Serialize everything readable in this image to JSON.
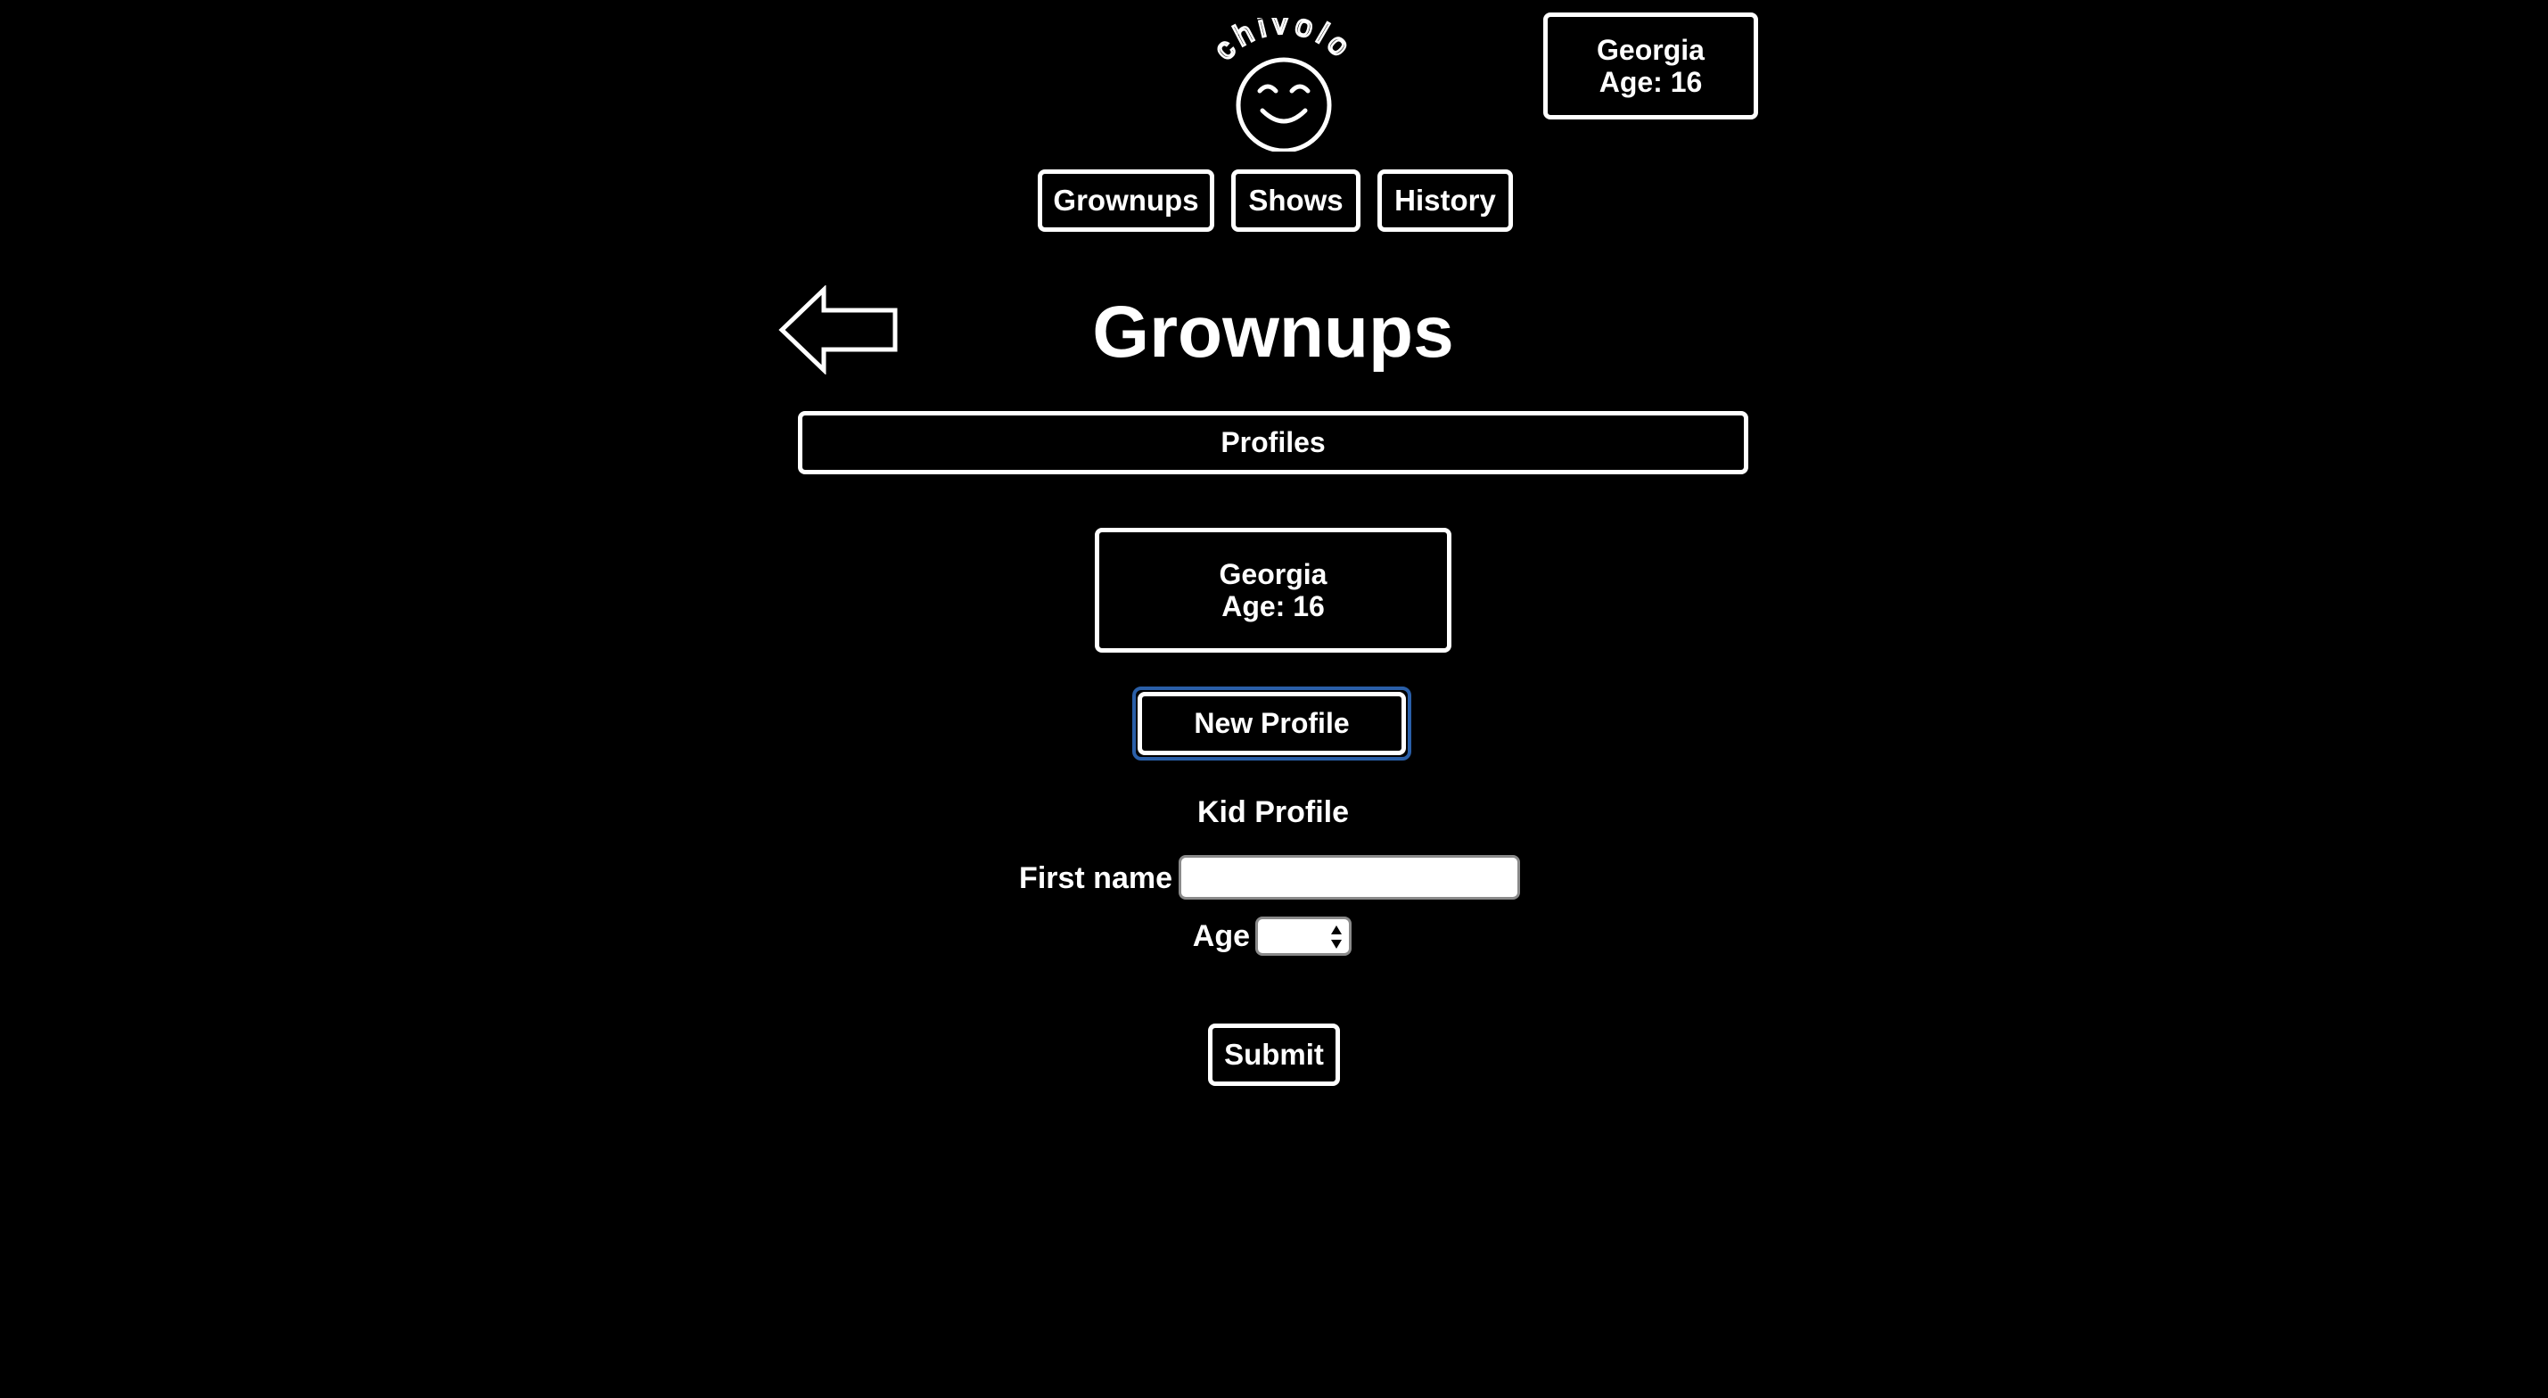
{
  "logo": {
    "wordmark": "chivolo",
    "icon": "smiley-sun-icon"
  },
  "current_profile": {
    "name": "Georgia",
    "age_text": "Age: 16"
  },
  "nav": {
    "items": [
      {
        "label": "Grownups"
      },
      {
        "label": "Shows"
      },
      {
        "label": "History"
      }
    ]
  },
  "page": {
    "back_icon": "arrow-left-icon",
    "title": "Grownups"
  },
  "profiles_section": {
    "label": "Profiles",
    "cards": [
      {
        "name": "Georgia",
        "age_text": "Age: 16"
      }
    ],
    "new_profile_label": "New Profile"
  },
  "form": {
    "heading": "Kid Profile",
    "first_name_label": "First name",
    "first_name_value": "",
    "first_name_placeholder": "",
    "age_label": "Age",
    "age_value": "",
    "age_icon": "up-down-stepper-icon",
    "submit_label": "Submit"
  },
  "colors": {
    "background": "#000000",
    "foreground": "#ffffff",
    "focus_ring": "#2a5fa8"
  }
}
